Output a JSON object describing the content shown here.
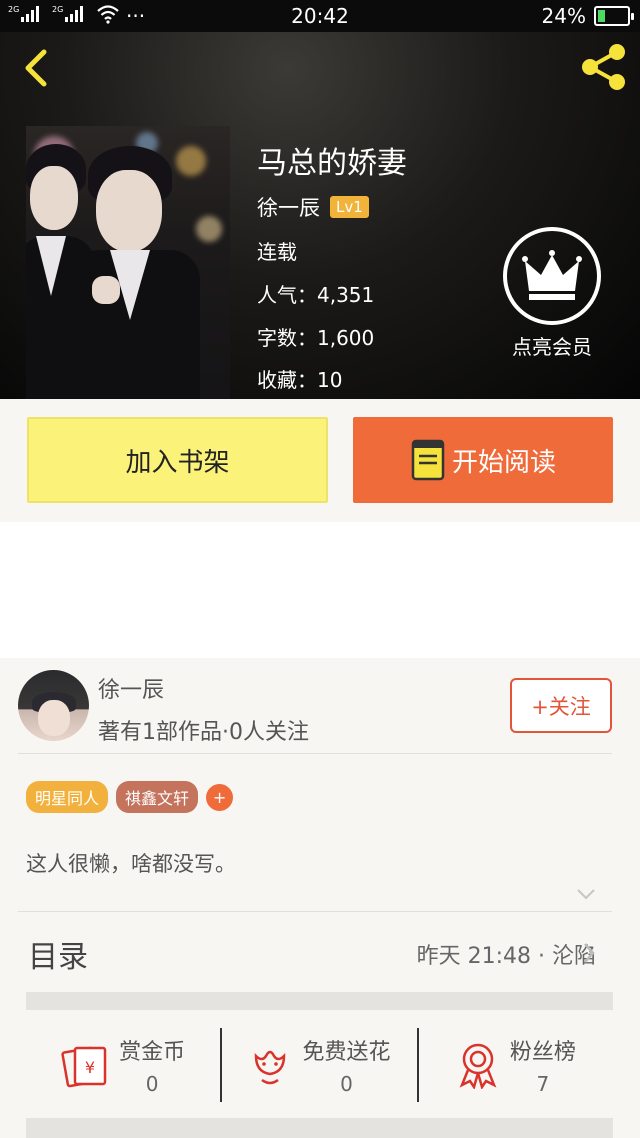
{
  "status_bar": {
    "signal_left": "2G",
    "signal_right": "2G",
    "dots": "···",
    "time": "20:42",
    "battery_text": "24%",
    "battery_level": 0.24
  },
  "book": {
    "title": "马总的娇妻",
    "author": "徐一辰",
    "level_badge": "Lv1",
    "status": "连载",
    "popularity": "人气：4,351",
    "word_count": "字数：1,600",
    "favorites": "收藏：10",
    "member_label": "点亮会员"
  },
  "actions": {
    "add_shelf": "加入书架",
    "start_read": "开始阅读"
  },
  "author_card": {
    "name": "徐一辰",
    "stats": "著有1部作品·0人关注",
    "follow_label": "+关注",
    "tags": [
      "明星同人",
      "祺鑫文轩"
    ],
    "add_tag": "+",
    "description": "这人很懒，啥都没写。"
  },
  "toc": {
    "title": "目录",
    "latest": "昨天 21:48 · 沦陷"
  },
  "rewards": [
    {
      "name": "赏金币",
      "value": "0",
      "icon": "reward-coin-icon"
    },
    {
      "name": "免费送花",
      "value": "0",
      "icon": "flower-icon"
    },
    {
      "name": "粉丝榜",
      "value": "7",
      "icon": "medal-icon"
    }
  ],
  "colors": {
    "accent_orange": "#ef6b3a",
    "accent_yellow": "#fbf27a",
    "icon_yellow": "#f5e23b",
    "follow_red": "#e2553a",
    "tag_yellow": "#f2b13c",
    "tag_brown": "#c4735c"
  }
}
